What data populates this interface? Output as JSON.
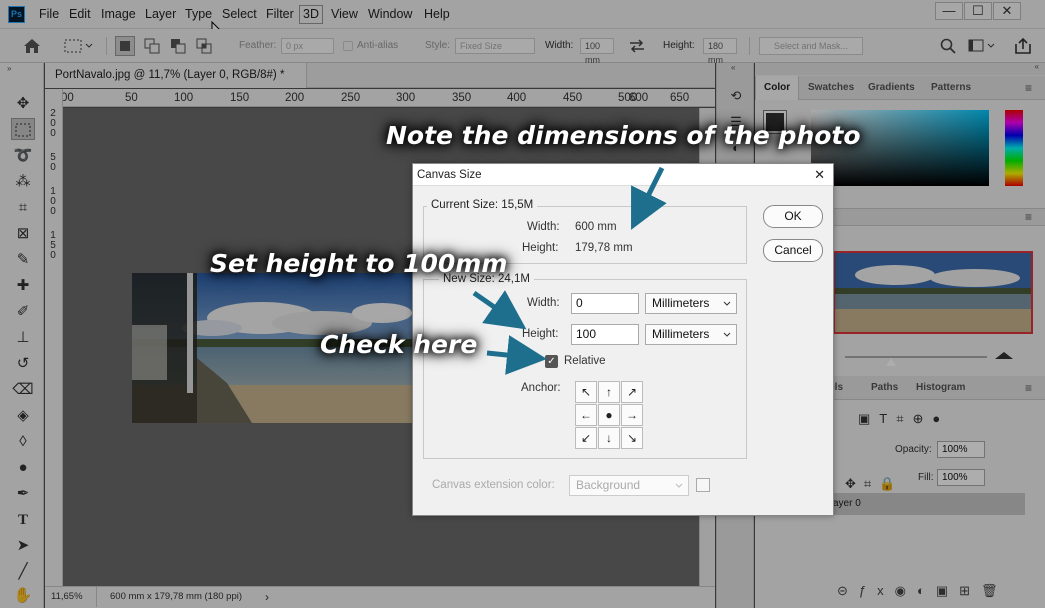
{
  "menubar": {
    "logo": "Ps",
    "items": [
      "File",
      "Edit",
      "Image",
      "Layer",
      "Type",
      "Select",
      "Filter",
      "3D",
      "View",
      "Window",
      "Help"
    ],
    "window_buttons": [
      "—",
      "☐",
      "✕"
    ]
  },
  "options": {
    "feather_label": "Feather:",
    "feather_value": "0 px",
    "antialias_label": "Anti-alias",
    "style_label": "Style:",
    "style_value": "Fixed Size",
    "width_label": "Width:",
    "width_value": "100 mm",
    "height_label": "Height:",
    "height_value": "180 mm",
    "select_mask_label": "Select and Mask..."
  },
  "document": {
    "tab_title": "PortNavalo.jpg @ 11,7% (Layer 0, RGB/8#) *",
    "tab_close": "×",
    "ruler_top": [
      "00",
      "50",
      "100",
      "150",
      "200",
      "250",
      "300",
      "350",
      "400",
      "450",
      "500",
      "550",
      "600",
      "650"
    ],
    "ruler_left": [
      "2",
      "0",
      "0",
      "5",
      "0",
      "1",
      "0",
      "0",
      "1",
      "5",
      "0"
    ],
    "zoom": "11,65%",
    "doc_info": "600 mm x 179,78 mm (180 ppi)",
    "status_arrow": "›"
  },
  "panels": {
    "color_tabs": [
      "Color",
      "Swatches",
      "Gradients",
      "Patterns"
    ],
    "layers_tabs": [
      "nels",
      "Paths",
      "Histogram"
    ],
    "opacity_label": "Opacity:",
    "opacity_value": "100%",
    "fill_label": "Fill:",
    "fill_value": "100%",
    "layer_name": "ayer 0"
  },
  "dialog": {
    "title": "Canvas Size",
    "close": "✕",
    "current_size_label": "Current Size: 15,5M",
    "current_width_label": "Width:",
    "current_width_value": "600 mm",
    "current_height_label": "Height:",
    "current_height_value": "179,78 mm",
    "new_size_label": "New Size: 24,1M",
    "width_label": "Width:",
    "width_value": "0",
    "width_unit": "Millimeters",
    "height_label": "Height:",
    "height_value": "100",
    "height_unit": "Millimeters",
    "relative_label": "Relative",
    "anchor_label": "Anchor:",
    "anchor_cells": [
      "↖",
      "↑",
      "↗",
      "←",
      "●",
      "→",
      "↙",
      "↓",
      "↘"
    ],
    "ext_color_label": "Canvas extension color:",
    "ext_color_value": "Background",
    "ok": "OK",
    "cancel": "Cancel"
  },
  "annotations": {
    "note_dimensions": "Note the dimensions of the photo",
    "set_height": "Set height to 100mm",
    "check_here": "Check here"
  },
  "colors": {
    "accent": "#1a6f8f",
    "photoshop_blue": "#31a8ff",
    "arrow": "#1e6e8e"
  }
}
